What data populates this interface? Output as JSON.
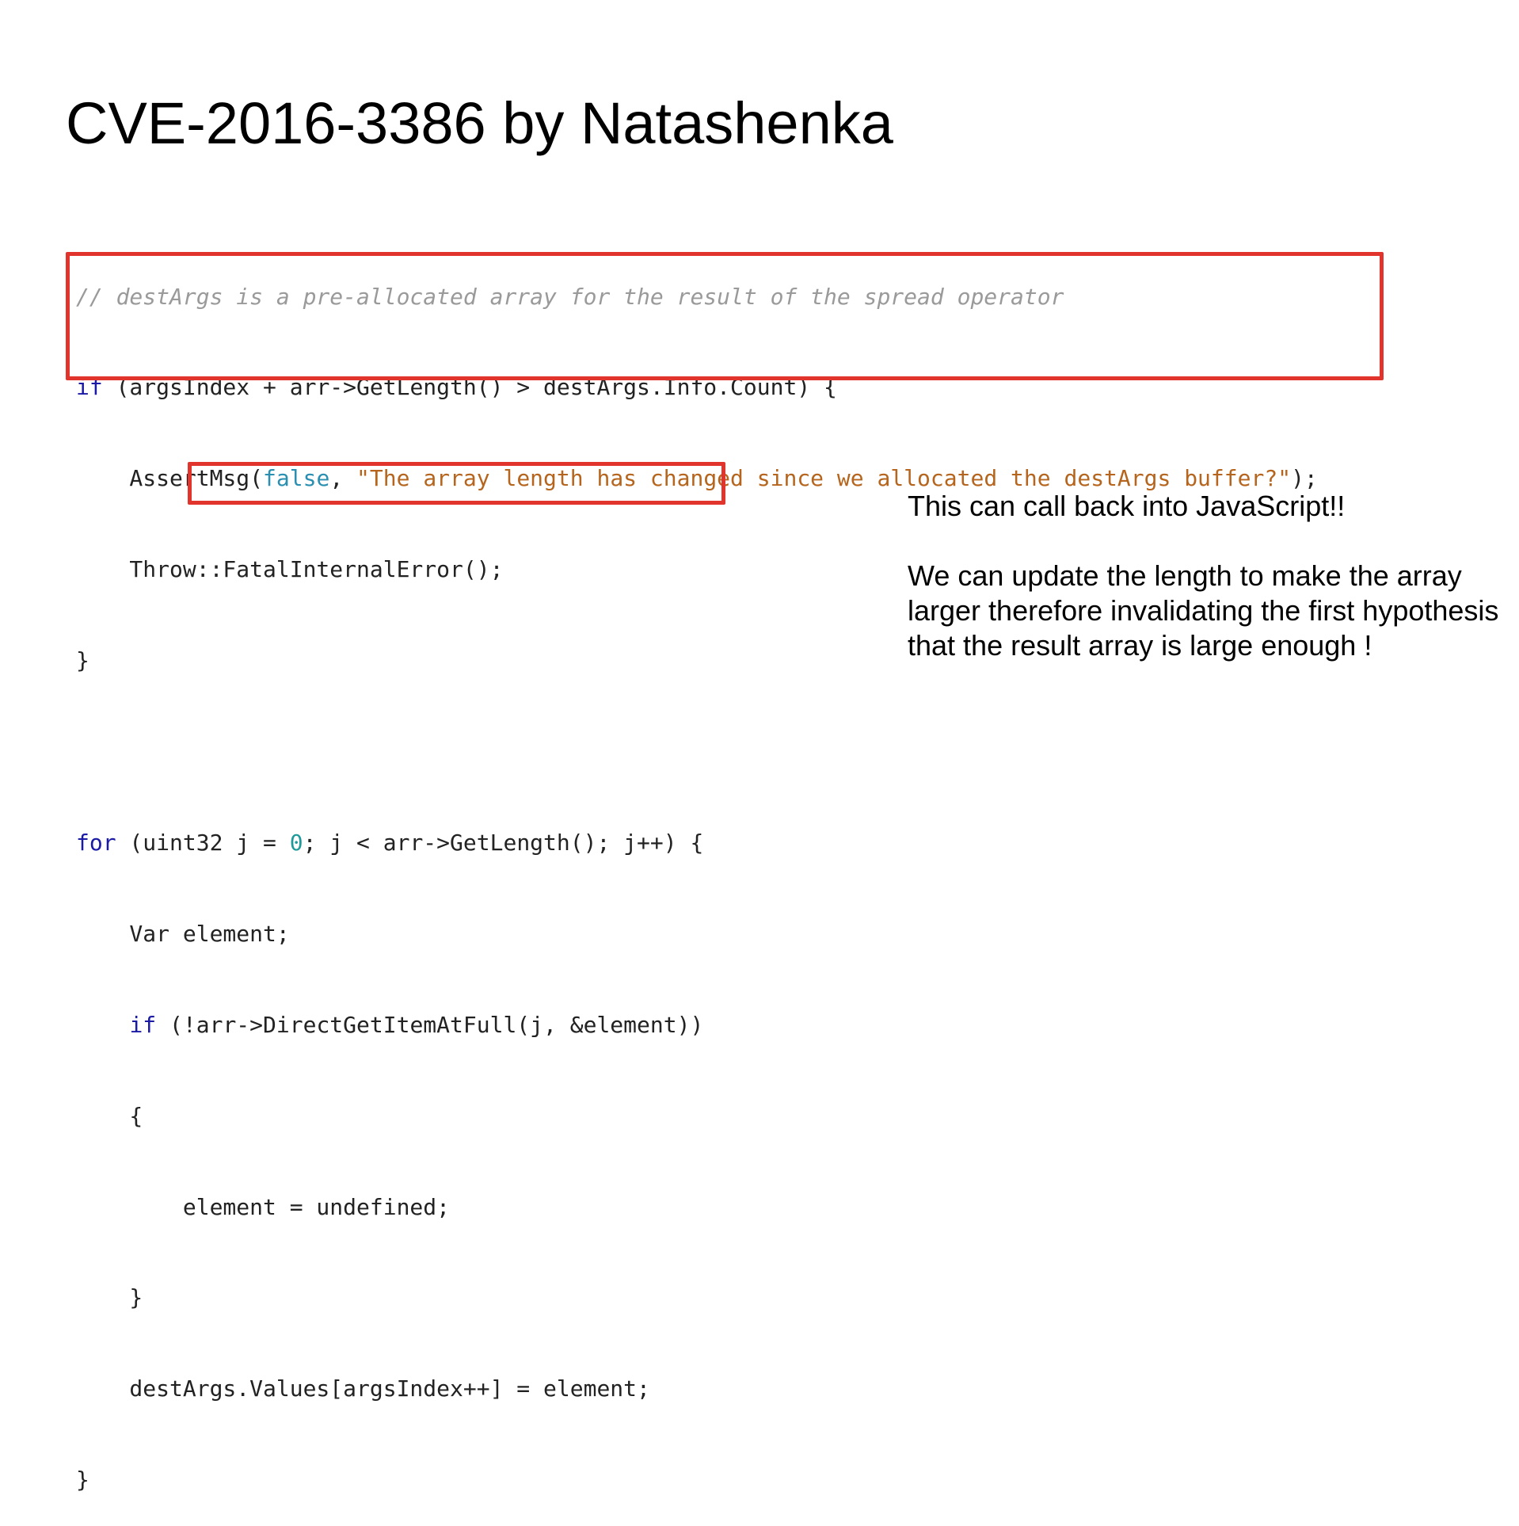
{
  "slide": {
    "title": "CVE-2016-3386 by Natashenka"
  },
  "code": {
    "comment": "// destArgs is a pre-allocated array for the result of the spread operator",
    "if1": {
      "kw": "if",
      "rest": " (argsIndex + arr->GetLength() > destArgs.Info.Count) {"
    },
    "assert": {
      "pre": "    AssertMsg(",
      "bool": "false",
      "mid": ", ",
      "str": "\"The array length has changed since we allocated the destArgs buffer?\"",
      "post": ");"
    },
    "throw_line": "    Throw::FatalInternalError();",
    "close1": "}",
    "for_line": {
      "kw": "for",
      "pre": " (uint32 j = ",
      "num": "0",
      "post": "; j < arr->GetLength(); j++) {"
    },
    "var_line": "    Var element;",
    "if2": {
      "indent": "    ",
      "kw": "if",
      "rest": " (!arr->DirectGetItemAtFull(j, &element))"
    },
    "open_brace": "    {",
    "assign_undef": "        element = undefined;",
    "close_inner": "    }",
    "dest_assign": "    destArgs.Values[argsIndex++] = element;",
    "close_outer": "}"
  },
  "notes": {
    "callback": "This can call back into JavaScript!!",
    "explanation": "We can update the length to make the array larger therefore invalidating the first hypothesis that the result array is large enough !"
  },
  "colors": {
    "highlight_border": "#e0342c",
    "keyword": "#1a1aa6",
    "string": "#b5651d",
    "boolean": "#2a8fb0",
    "number": "#1f9a9a",
    "comment": "#9a9a9a"
  }
}
